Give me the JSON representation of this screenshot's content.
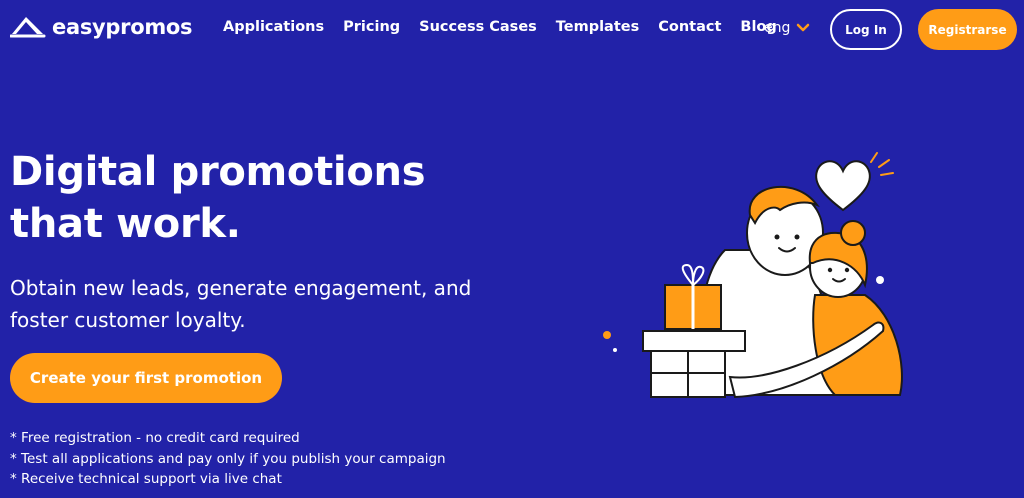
{
  "brand": {
    "name": "easypromos"
  },
  "nav": {
    "items": [
      {
        "label": "Applications"
      },
      {
        "label": "Pricing"
      },
      {
        "label": "Success Cases"
      },
      {
        "label": "Templates"
      },
      {
        "label": "Contact"
      },
      {
        "label": "Blog"
      }
    ],
    "language": "eng",
    "login_label": "Log In",
    "register_label": "Registrarse"
  },
  "hero": {
    "title": "Digital promotions that work.",
    "subtitle": "Obtain new leads, generate engagement, and foster customer loyalty.",
    "cta_label": "Create your first promotion",
    "notes": [
      "* Free registration - no credit card required",
      "* Test all applications and pay only if you publish your campaign",
      "* Receive technical support via live chat"
    ]
  },
  "colors": {
    "background": "#2222a8",
    "accent": "#ff9c16",
    "text": "#ffffff"
  },
  "icons": {
    "logo": "easypromos-logo-icon",
    "language_chevron": "chevron-down-icon",
    "illustration": "hug-gift-heart-illustration"
  }
}
